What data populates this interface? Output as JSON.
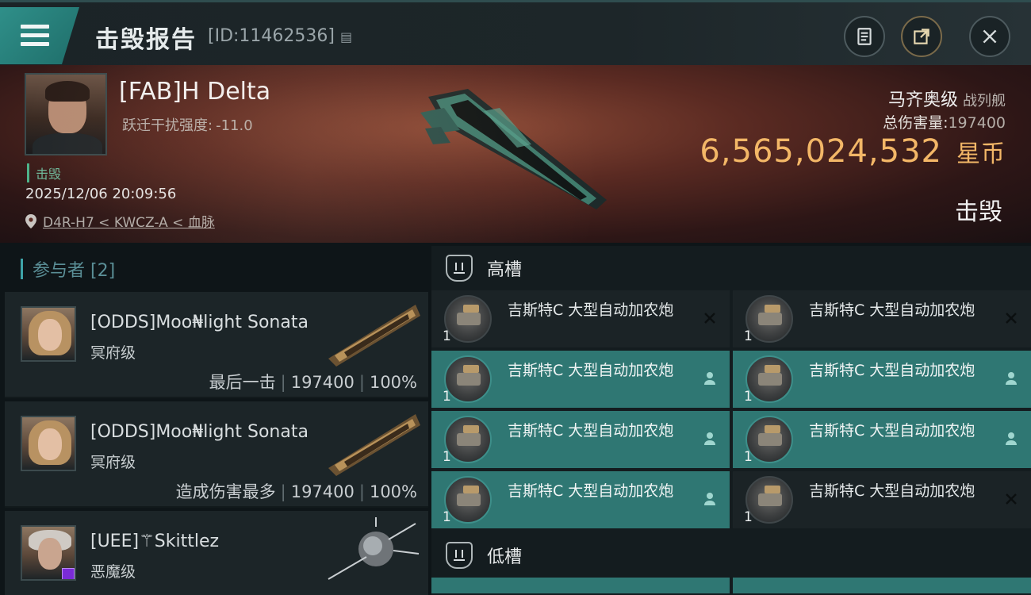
{
  "header": {
    "title": "击毁报告",
    "report_id": "[ID:11462536]",
    "copy_id_icon": "copy-icon",
    "clipboard_icon": "clipboard-icon",
    "share_icon": "share-icon",
    "close_icon": "close-icon"
  },
  "victim": {
    "pilot_name": "[FAB]H Delta",
    "warp_label": "跃迁干扰强度:",
    "warp_value": "-11.0",
    "status": "击毁",
    "timestamp": "2025/12/06 20:09:56",
    "location": "D4R-H7 < KWCZ-A < 血脉",
    "ship_name": "马齐奥级",
    "ship_type": "战列舰",
    "total_damage_label": "总伤害量:",
    "total_damage": "197400",
    "isk_value": "6,565,024,532",
    "isk_unit": "星币",
    "result": "击毁"
  },
  "participants": {
    "title": "参与者 [2]",
    "items": [
      {
        "name": "[ODDS]Moo₦light Sonata",
        "ship": "冥府级",
        "role": "最后一击",
        "damage": "197400",
        "percent": "100%"
      },
      {
        "name": "[ODDS]Moo₦light Sonata",
        "ship": "冥府级",
        "role": "造成伤害最多",
        "damage": "197400",
        "percent": "100%"
      },
      {
        "name": "[UEE]⚚Skittlez",
        "ship": "恶魔级"
      }
    ]
  },
  "high_slots": {
    "title": "高槽",
    "modules": [
      {
        "name": "吉斯特C 大型自动加农炮",
        "qty": "1",
        "state": "destroyed"
      },
      {
        "name": "吉斯特C 大型自动加农炮",
        "qty": "1",
        "state": "destroyed"
      },
      {
        "name": "吉斯特C 大型自动加农炮",
        "qty": "1",
        "state": "dropped"
      },
      {
        "name": "吉斯特C 大型自动加农炮",
        "qty": "1",
        "state": "dropped"
      },
      {
        "name": "吉斯特C 大型自动加农炮",
        "qty": "1",
        "state": "dropped"
      },
      {
        "name": "吉斯特C 大型自动加农炮",
        "qty": "1",
        "state": "dropped"
      },
      {
        "name": "吉斯特C 大型自动加农炮",
        "qty": "1",
        "state": "dropped"
      },
      {
        "name": "吉斯特C 大型自动加农炮",
        "qty": "1",
        "state": "destroyed"
      }
    ]
  },
  "low_slots": {
    "title": "低槽"
  },
  "colors": {
    "accent_teal": "#2f7773",
    "isk_gold": "#f3b767",
    "status_green": "#4db38a"
  }
}
